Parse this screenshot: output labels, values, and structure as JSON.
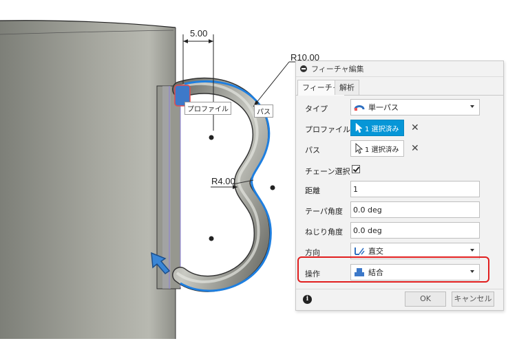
{
  "viewport": {
    "dims": {
      "width": "5.00",
      "radius_outer": "R10.00",
      "radius_inner": "R4.00"
    },
    "labels": {
      "profile": "プロファイル",
      "path": "パス"
    }
  },
  "dialog": {
    "title": "フィーチャ編集",
    "tabs": [
      {
        "label": "フィーチャ",
        "active": true
      },
      {
        "label": "解析",
        "active": false
      }
    ],
    "rows": {
      "type": {
        "label": "タイプ",
        "value": "単一パス"
      },
      "profile": {
        "label": "プロファイル",
        "value": "1 選択済み"
      },
      "path": {
        "label": "パス",
        "value": "1 選択済み"
      },
      "chain": {
        "label": "チェーン選択",
        "checked": true
      },
      "distance": {
        "label": "距離",
        "value": "1"
      },
      "taper": {
        "label": "テーパ角度",
        "value": "0.0 deg"
      },
      "twist": {
        "label": "ねじり角度",
        "value": "0.0 deg"
      },
      "direction": {
        "label": "方向",
        "value": "直交"
      },
      "operation": {
        "label": "操作",
        "value": "結合"
      }
    },
    "buttons": {
      "ok": "OK",
      "cancel": "キャンセル"
    }
  },
  "colors": {
    "accent": "#0696d7",
    "highlight": "#e11d1d",
    "path_blue": "#1e7fe0"
  }
}
